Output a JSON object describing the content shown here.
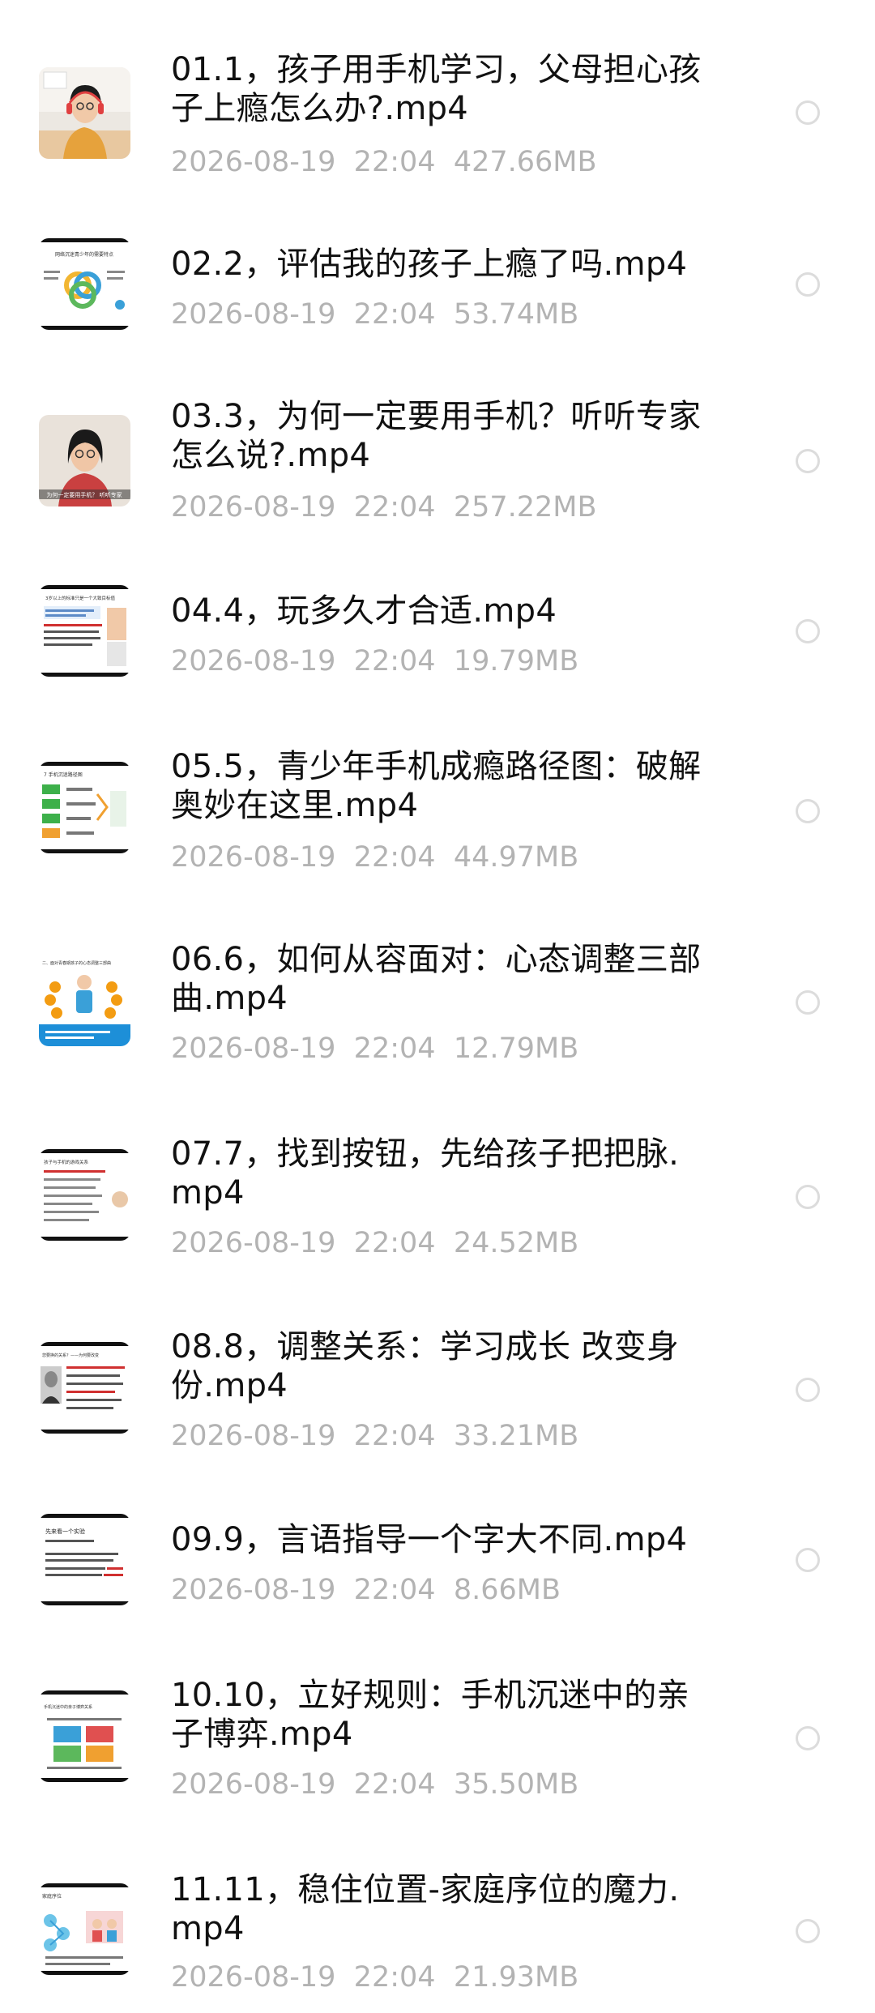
{
  "files": [
    {
      "name": "01.1，孩子用手机学习，父母担心孩子上瘾怎么办?.mp4",
      "date": "2026-08-19",
      "time": "22:04",
      "size": "427.66MB",
      "thumb": "person-video-thumbnail"
    },
    {
      "name": "02.2，评估我的孩子上瘾了吗.mp4",
      "date": "2026-08-19",
      "time": "22:04",
      "size": "53.74MB",
      "thumb": "slide-thumbnail"
    },
    {
      "name": "03.3，为何一定要用手机？听听专家怎么说?.mp4",
      "date": "2026-08-19",
      "time": "22:04",
      "size": "257.22MB",
      "thumb": "person-video-thumbnail"
    },
    {
      "name": "04.4，玩多久才合适.mp4",
      "date": "2026-08-19",
      "time": "22:04",
      "size": "19.79MB",
      "thumb": "slide-thumbnail"
    },
    {
      "name": "05.5，青少年手机成瘾路径图：破解奥妙在这里.mp4",
      "date": "2026-08-19",
      "time": "22:04",
      "size": "44.97MB",
      "thumb": "slide-thumbnail"
    },
    {
      "name": "06.6，如何从容面对：心态调整三部曲.mp4",
      "date": "2026-08-19",
      "time": "22:04",
      "size": "12.79MB",
      "thumb": "slide-thumbnail"
    },
    {
      "name": "07.7，找到按钮，先给孩子把把脉.mp4",
      "date": "2026-08-19",
      "time": "22:04",
      "size": "24.52MB",
      "thumb": "slide-thumbnail"
    },
    {
      "name": "08.8，调整关系：学习成长 改变身份.mp4",
      "date": "2026-08-19",
      "time": "22:04",
      "size": "33.21MB",
      "thumb": "slide-thumbnail"
    },
    {
      "name": "09.9，言语指导一个字大不同.mp4",
      "date": "2026-08-19",
      "time": "22:04",
      "size": "8.66MB",
      "thumb": "slide-thumbnail"
    },
    {
      "name": "10.10，立好规则：手机沉迷中的亲子博弈.mp4",
      "date": "2026-08-19",
      "time": "22:04",
      "size": "35.50MB",
      "thumb": "slide-thumbnail"
    },
    {
      "name": "11.11，稳住位置-家庭序位的魔力.mp4",
      "date": "2026-08-19",
      "time": "22:04",
      "size": "21.93MB",
      "thumb": "slide-thumbnail"
    }
  ],
  "thumb_texts": {
    "t2": "网络沉迷青少年的需要特点",
    "t3": "为何一定要用手机？ 听听专家",
    "t4": "3岁以上的标准只是一个大致目标值",
    "t5": "7 手机沉迷路径图",
    "t6": "二、面对青春期孩子的心态调整三部曲",
    "t7": "孩子与手机的游戏关系",
    "t8": "您要换的关系？——为何要改变",
    "t9": "先来看一个实验",
    "t10": "手机沉迷中的亲子博弈关系",
    "t11": "家庭序位"
  }
}
